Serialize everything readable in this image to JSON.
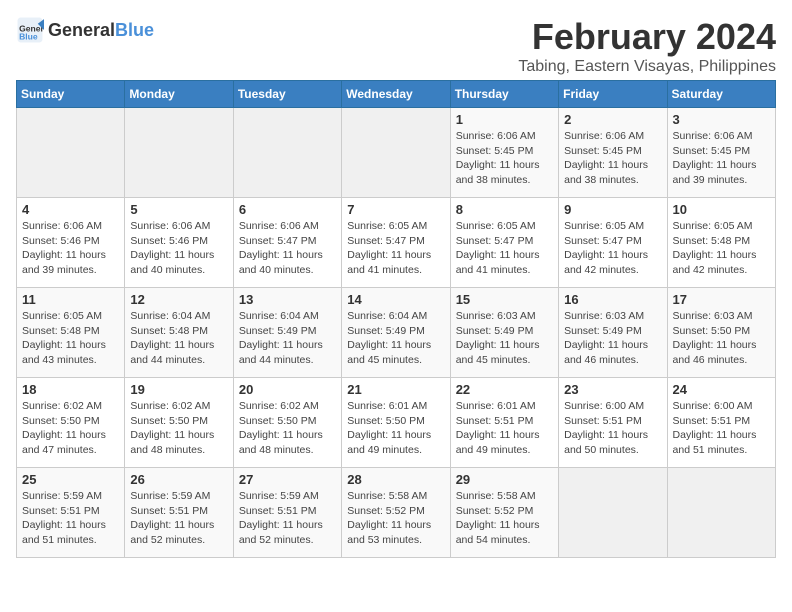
{
  "header": {
    "logo_general": "General",
    "logo_blue": "Blue",
    "month_year": "February 2024",
    "location": "Tabing, Eastern Visayas, Philippines"
  },
  "days_of_week": [
    "Sunday",
    "Monday",
    "Tuesday",
    "Wednesday",
    "Thursday",
    "Friday",
    "Saturday"
  ],
  "weeks": [
    [
      {
        "day": "",
        "empty": true
      },
      {
        "day": "",
        "empty": true
      },
      {
        "day": "",
        "empty": true
      },
      {
        "day": "",
        "empty": true
      },
      {
        "day": "1",
        "sunrise": "6:06 AM",
        "sunset": "5:45 PM",
        "daylight": "11 hours and 38 minutes."
      },
      {
        "day": "2",
        "sunrise": "6:06 AM",
        "sunset": "5:45 PM",
        "daylight": "11 hours and 38 minutes."
      },
      {
        "day": "3",
        "sunrise": "6:06 AM",
        "sunset": "5:45 PM",
        "daylight": "11 hours and 39 minutes."
      }
    ],
    [
      {
        "day": "4",
        "sunrise": "6:06 AM",
        "sunset": "5:46 PM",
        "daylight": "11 hours and 39 minutes."
      },
      {
        "day": "5",
        "sunrise": "6:06 AM",
        "sunset": "5:46 PM",
        "daylight": "11 hours and 40 minutes."
      },
      {
        "day": "6",
        "sunrise": "6:06 AM",
        "sunset": "5:47 PM",
        "daylight": "11 hours and 40 minutes."
      },
      {
        "day": "7",
        "sunrise": "6:05 AM",
        "sunset": "5:47 PM",
        "daylight": "11 hours and 41 minutes."
      },
      {
        "day": "8",
        "sunrise": "6:05 AM",
        "sunset": "5:47 PM",
        "daylight": "11 hours and 41 minutes."
      },
      {
        "day": "9",
        "sunrise": "6:05 AM",
        "sunset": "5:47 PM",
        "daylight": "11 hours and 42 minutes."
      },
      {
        "day": "10",
        "sunrise": "6:05 AM",
        "sunset": "5:48 PM",
        "daylight": "11 hours and 42 minutes."
      }
    ],
    [
      {
        "day": "11",
        "sunrise": "6:05 AM",
        "sunset": "5:48 PM",
        "daylight": "11 hours and 43 minutes."
      },
      {
        "day": "12",
        "sunrise": "6:04 AM",
        "sunset": "5:48 PM",
        "daylight": "11 hours and 44 minutes."
      },
      {
        "day": "13",
        "sunrise": "6:04 AM",
        "sunset": "5:49 PM",
        "daylight": "11 hours and 44 minutes."
      },
      {
        "day": "14",
        "sunrise": "6:04 AM",
        "sunset": "5:49 PM",
        "daylight": "11 hours and 45 minutes."
      },
      {
        "day": "15",
        "sunrise": "6:03 AM",
        "sunset": "5:49 PM",
        "daylight": "11 hours and 45 minutes."
      },
      {
        "day": "16",
        "sunrise": "6:03 AM",
        "sunset": "5:49 PM",
        "daylight": "11 hours and 46 minutes."
      },
      {
        "day": "17",
        "sunrise": "6:03 AM",
        "sunset": "5:50 PM",
        "daylight": "11 hours and 46 minutes."
      }
    ],
    [
      {
        "day": "18",
        "sunrise": "6:02 AM",
        "sunset": "5:50 PM",
        "daylight": "11 hours and 47 minutes."
      },
      {
        "day": "19",
        "sunrise": "6:02 AM",
        "sunset": "5:50 PM",
        "daylight": "11 hours and 48 minutes."
      },
      {
        "day": "20",
        "sunrise": "6:02 AM",
        "sunset": "5:50 PM",
        "daylight": "11 hours and 48 minutes."
      },
      {
        "day": "21",
        "sunrise": "6:01 AM",
        "sunset": "5:50 PM",
        "daylight": "11 hours and 49 minutes."
      },
      {
        "day": "22",
        "sunrise": "6:01 AM",
        "sunset": "5:51 PM",
        "daylight": "11 hours and 49 minutes."
      },
      {
        "day": "23",
        "sunrise": "6:00 AM",
        "sunset": "5:51 PM",
        "daylight": "11 hours and 50 minutes."
      },
      {
        "day": "24",
        "sunrise": "6:00 AM",
        "sunset": "5:51 PM",
        "daylight": "11 hours and 51 minutes."
      }
    ],
    [
      {
        "day": "25",
        "sunrise": "5:59 AM",
        "sunset": "5:51 PM",
        "daylight": "11 hours and 51 minutes."
      },
      {
        "day": "26",
        "sunrise": "5:59 AM",
        "sunset": "5:51 PM",
        "daylight": "11 hours and 52 minutes."
      },
      {
        "day": "27",
        "sunrise": "5:59 AM",
        "sunset": "5:51 PM",
        "daylight": "11 hours and 52 minutes."
      },
      {
        "day": "28",
        "sunrise": "5:58 AM",
        "sunset": "5:52 PM",
        "daylight": "11 hours and 53 minutes."
      },
      {
        "day": "29",
        "sunrise": "5:58 AM",
        "sunset": "5:52 PM",
        "daylight": "11 hours and 54 minutes."
      },
      {
        "day": "",
        "empty": true
      },
      {
        "day": "",
        "empty": true
      }
    ]
  ],
  "labels": {
    "sunrise": "Sunrise:",
    "sunset": "Sunset:",
    "daylight": "Daylight:"
  }
}
